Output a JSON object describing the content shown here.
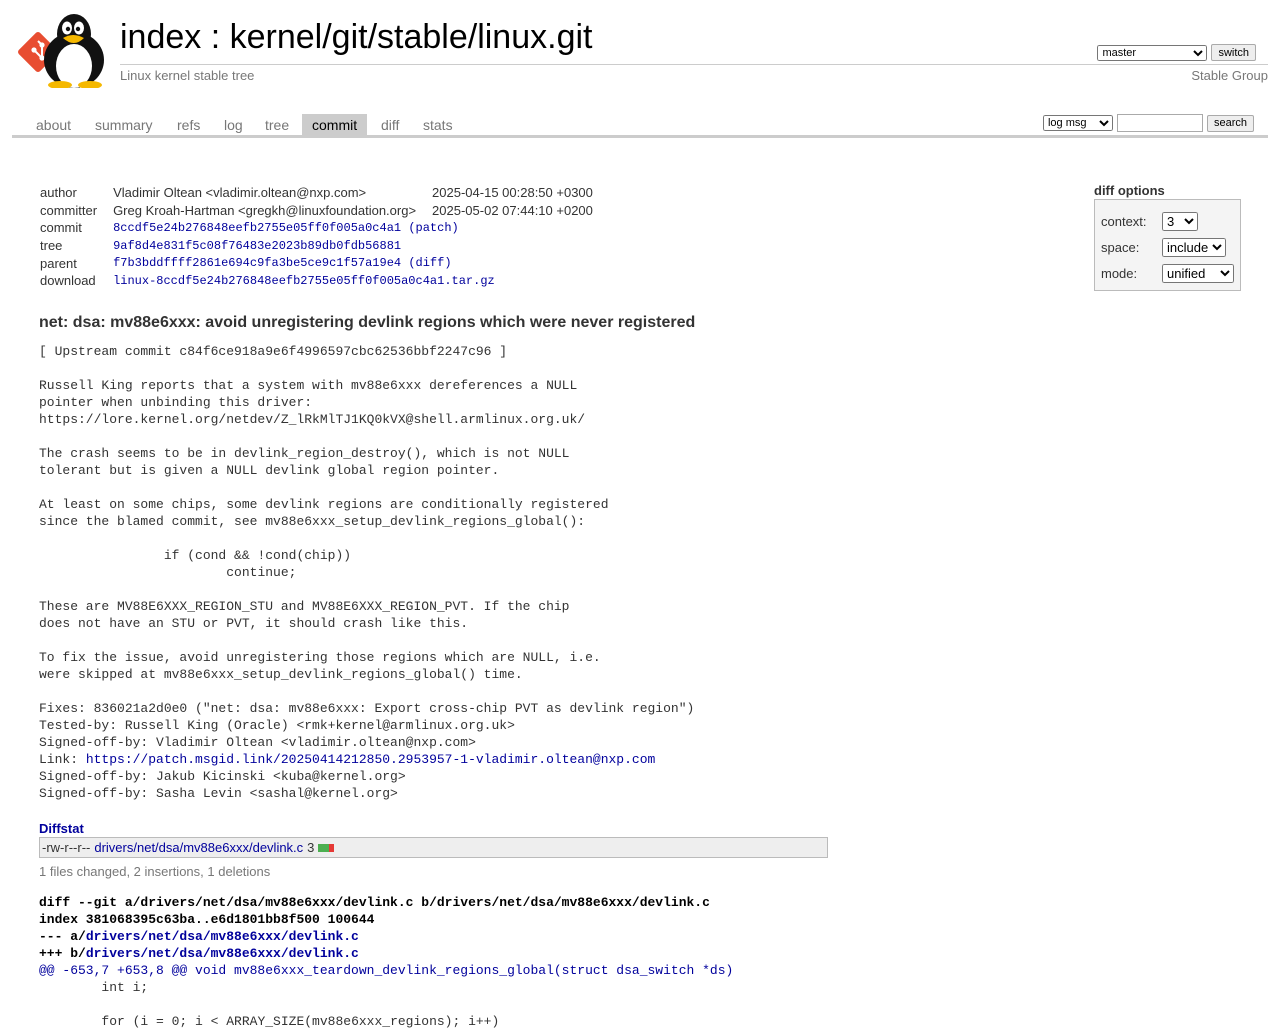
{
  "header": {
    "title_index": "index",
    "title_sep": " : ",
    "title_repo": "kernel/git/stable/linux.git",
    "description": "Linux kernel stable tree",
    "owner": "Stable Group",
    "branch_selected": "master",
    "switch_label": "switch"
  },
  "tabs": [
    "about",
    "summary",
    "refs",
    "log",
    "tree",
    "commit",
    "diff",
    "stats"
  ],
  "active_tab": "commit",
  "search": {
    "mode_selected": "log msg",
    "value": "",
    "button_label": "search"
  },
  "commit_info": {
    "author_label": "author",
    "author": "Vladimir Oltean <vladimir.oltean@nxp.com>",
    "author_date": "2025-04-15 00:28:50 +0300",
    "committer_label": "committer",
    "committer": "Greg Kroah-Hartman <gregkh@linuxfoundation.org>",
    "committer_date": "2025-05-02 07:44:10 +0200",
    "commit_label": "commit",
    "commit": "8ccdf5e24b276848eefb2755e05ff0f005a0c4a1",
    "commit_extra": "(patch)",
    "tree_label": "tree",
    "tree": "9af8d4e831f5c08f76483e2023b89db0fdb56881",
    "parent_label": "parent",
    "parent": "f7b3bddffff2861e694c9fa3be5ce9c1f57a19e4",
    "parent_extra": "(diff)",
    "download_label": "download",
    "download": "linux-8ccdf5e24b276848eefb2755e05ff0f005a0c4a1.tar.gz"
  },
  "diff_options": {
    "heading": "diff options",
    "context_label": "context:",
    "context_value": "3",
    "space_label": "space:",
    "space_value": "include",
    "mode_label": "mode:",
    "mode_value": "unified"
  },
  "subject": "net: dsa: mv88e6xxx: avoid unregistering devlink regions which were never registered",
  "message": {
    "body": "[ Upstream commit c84f6ce918a9e6f4996597cbc62536bbf2247c96 ]\n\nRussell King reports that a system with mv88e6xxx dereferences a NULL\npointer when unbinding this driver:\nhttps://lore.kernel.org/netdev/Z_lRkMlTJ1KQ0kVX@shell.armlinux.org.uk/\n\nThe crash seems to be in devlink_region_destroy(), which is not NULL\ntolerant but is given a NULL devlink global region pointer.\n\nAt least on some chips, some devlink regions are conditionally registered\nsince the blamed commit, see mv88e6xxx_setup_devlink_regions_global():\n\n\t\tif (cond && !cond(chip))\n\t\t\tcontinue;\n\nThese are MV88E6XXX_REGION_STU and MV88E6XXX_REGION_PVT. If the chip\ndoes not have an STU or PVT, it should crash like this.\n\nTo fix the issue, avoid unregistering those regions which are NULL, i.e.\nwere skipped at mv88e6xxx_setup_devlink_regions_global() time.\n\nFixes: 836021a2d0e0 (\"net: dsa: mv88e6xxx: Export cross-chip PVT as devlink region\")\nTested-by: Russell King (Oracle) <rmk+kernel@armlinux.org.uk>\nSigned-off-by: Vladimir Oltean <vladimir.oltean@nxp.com>",
    "link_prefix": "Link: ",
    "link": "https://patch.msgid.link/20250414212850.2953957-1-vladimir.oltean@nxp.com",
    "tail": "Signed-off-by: Jakub Kicinski <kuba@kernel.org>\nSigned-off-by: Sasha Levin <sashal@kernel.org>"
  },
  "diffstat": {
    "heading": "Diffstat",
    "mode": "-rw-r--r--",
    "file": "drivers/net/dsa/mv88e6xxx/devlink.c",
    "changes": "3",
    "insertions_fraction": 0.667,
    "summary": "1 files changed, 2 insertions, 1 deletions",
    "colors": {
      "insert": "#4caf50",
      "delete": "#e53935"
    }
  },
  "diff": {
    "line1": "diff --git a/drivers/net/dsa/mv88e6xxx/devlink.c b/drivers/net/dsa/mv88e6xxx/devlink.c",
    "line2": "index 381068395c63ba..e6d1801bb8f500 100644",
    "minus_prefix": "--- a/",
    "plus_prefix": "+++ b/",
    "file": "drivers/net/dsa/mv88e6xxx/devlink.c",
    "hunk": "@@ -653,7 +653,8 @@ void mv88e6xxx_teardown_devlink_regions_global(struct dsa_switch *ds)",
    "ctx1": "\tint i;",
    "ctx2": "",
    "ctx3": "\tfor (i = 0; i < ARRAY_SIZE(mv88e6xxx_regions); i++)"
  }
}
